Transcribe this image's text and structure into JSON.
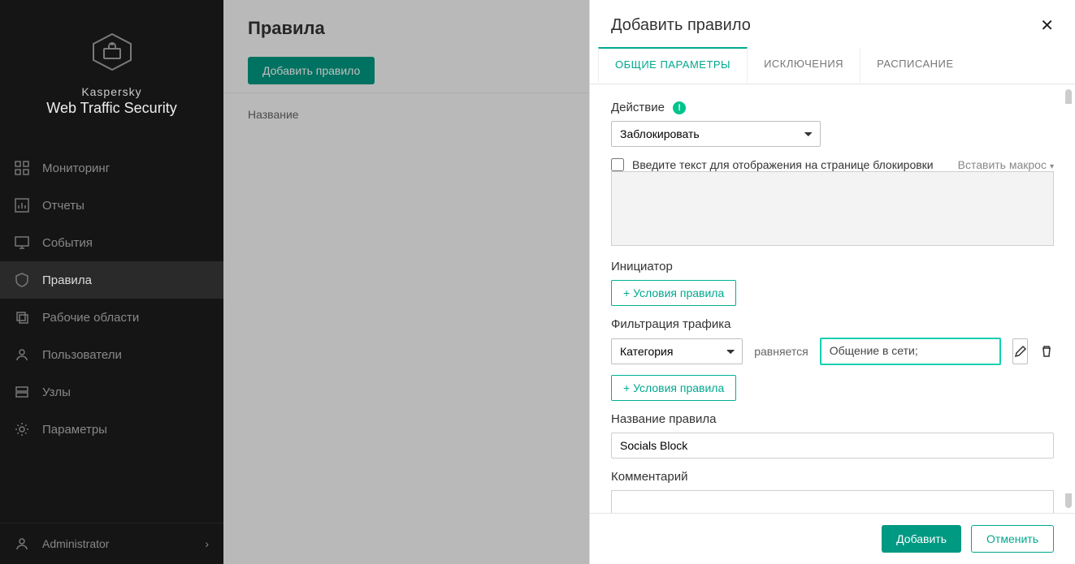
{
  "brand": {
    "line1": "Kaspersky",
    "line2": "Web Traffic Security"
  },
  "sidebar": {
    "items": [
      {
        "label": "Мониторинг"
      },
      {
        "label": "Отчеты"
      },
      {
        "label": "События"
      },
      {
        "label": "Правила"
      },
      {
        "label": "Рабочие области"
      },
      {
        "label": "Пользователи"
      },
      {
        "label": "Узлы"
      },
      {
        "label": "Параметры"
      }
    ],
    "footer": {
      "label": "Administrator"
    }
  },
  "page": {
    "title": "Правила",
    "add_rule_btn": "Добавить правило",
    "column_header": "Название"
  },
  "modal": {
    "title": "Добавить правило",
    "tabs": {
      "general": "ОБЩИЕ ПАРАМЕТРЫ",
      "exclusions": "ИСКЛЮЧЕНИЯ",
      "schedule": "РАСПИСАНИЕ"
    },
    "action_label": "Действие",
    "action_value": "Заблокировать",
    "block_text_check_label": "Введите текст для отображения на странице блокировки",
    "insert_macro": "Вставить макрос",
    "block_textarea_value": "",
    "initiator_label": "Инициатор",
    "add_condition_btn": "+ Условия правила",
    "traffic_filter_label": "Фильтрация трафика",
    "filter_field_value": "Категория",
    "equals_label": "равняется",
    "category_value": "Общение в сети;",
    "rule_name_label": "Название правила",
    "rule_name_value": "Socials Block",
    "comment_label": "Комментарий",
    "comment_value": "",
    "buttons": {
      "add": "Добавить",
      "cancel": "Отменить"
    }
  }
}
